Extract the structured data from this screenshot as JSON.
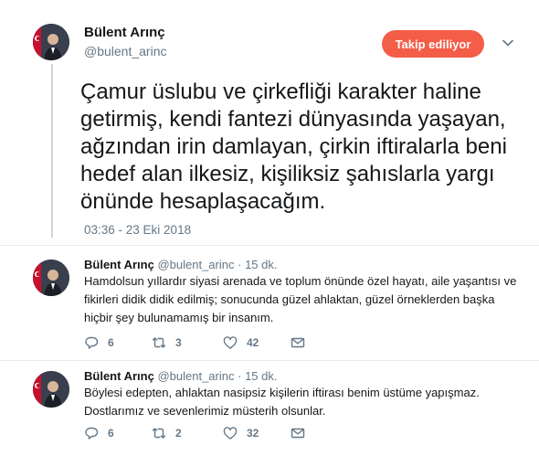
{
  "main_tweet": {
    "name": "Bülent Arınç",
    "handle": "@bulent_arinc",
    "follow_button": "Takip ediliyor",
    "text": "Çamur üslubu ve çirkefliği karakter haline getirmiş, kendi fantezi dünyasında yaşayan, ağzından irin damlayan, çirkin iftiralarla beni hedef alan ilkesiz, kişiliksiz şahıslarla yargı önünde hesaplaşacağım.",
    "timestamp": "03:36 - 23 Eki 2018"
  },
  "replies": [
    {
      "name": "Bülent Arınç",
      "handle": "@bulent_arinc",
      "separator": "·",
      "time": "15 dk.",
      "text": "Hamdolsun yıllardır siyasi arenada ve toplum önünde özel hayatı, aile yaşantısı ve fikirleri didik didik edilmiş; sonucunda güzel ahlaktan, güzel örneklerden başka hiçbir şey bulunamamış bir insanım.",
      "reply_count": "6",
      "retweet_count": "3",
      "like_count": "42"
    },
    {
      "name": "Bülent Arınç",
      "handle": "@bulent_arinc",
      "separator": "·",
      "time": "15 dk.",
      "text": "Böylesi edepten, ahlaktan nasipsiz kişilerin iftirası benim üstüme yapışmaz. Dostlarımız ve sevenlerimiz müsterih olsunlar.",
      "reply_count": "6",
      "retweet_count": "2",
      "like_count": "32"
    }
  ],
  "icons": {
    "reply": "reply-icon",
    "retweet": "retweet-icon",
    "like": "heart-icon",
    "message": "envelope-icon",
    "more": "chevron-down-icon"
  },
  "colors": {
    "follow_button": "#f45d48",
    "secondary_text": "#657786",
    "thread_line": "#ccd6dd"
  }
}
